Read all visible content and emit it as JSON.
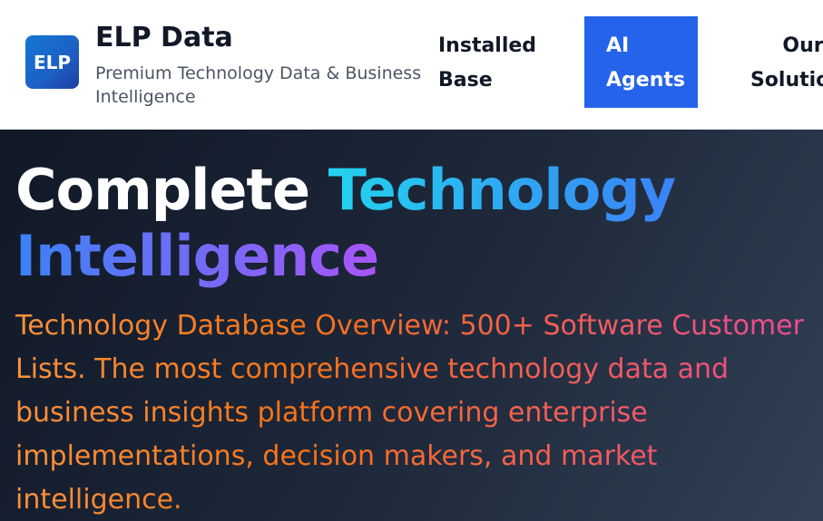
{
  "header": {
    "logo_text": "ELP",
    "brand_name": "ELP Data",
    "tagline": "Premium Technology Data & Business Intelligence",
    "nav": [
      {
        "label": "Installed Base"
      },
      {
        "label": "AI Agents",
        "active": true
      },
      {
        "label": "Our Solutions"
      }
    ]
  },
  "hero": {
    "title_part1": "Complete",
    "title_part2": "Technology",
    "title_part3": "Intelligence",
    "description": "Technology Database Overview: 500+ Software Customer Lists. The most comprehensive technology data and business insights platform covering enterprise implementations, decision makers, and market intelligence."
  },
  "colors": {
    "accent": "#2563eb",
    "hero_bg": "#1e293b",
    "title_gradient_start": "#22d3ee",
    "title_gradient_end": "#a855f7",
    "description_gradient_start": "#fb923c",
    "description_gradient_end": "#ec4899"
  }
}
